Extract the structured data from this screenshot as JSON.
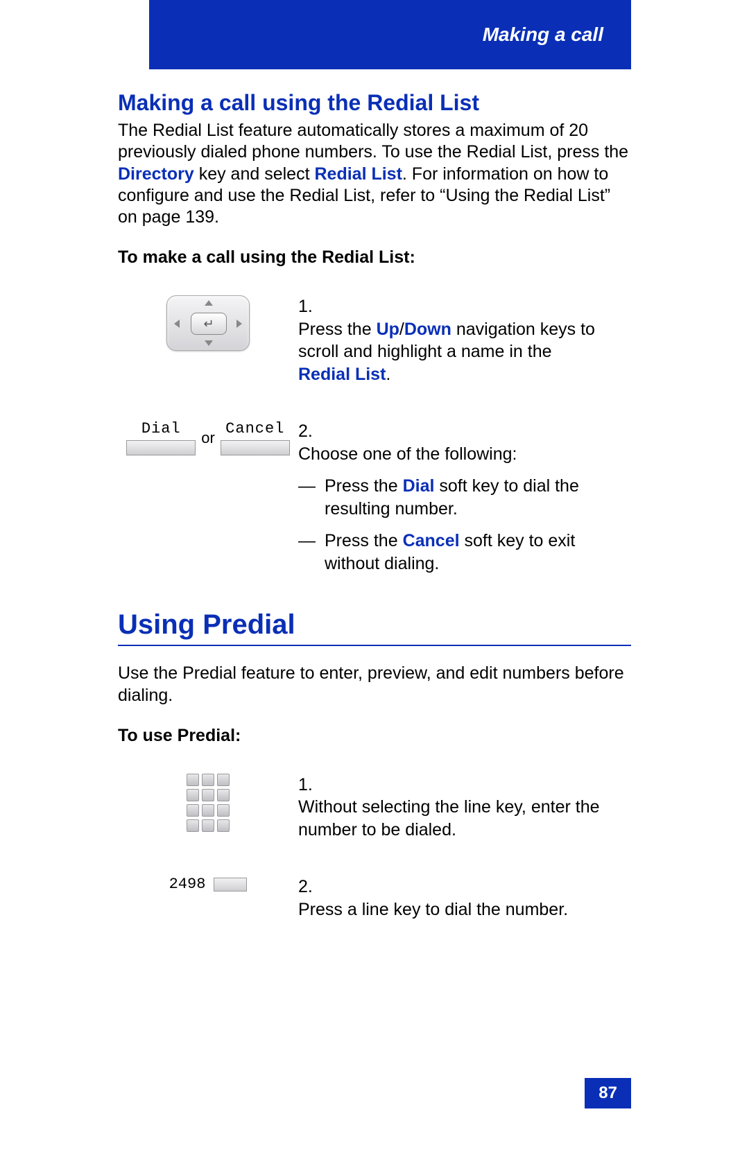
{
  "header": {
    "breadcrumb": "Making a call"
  },
  "section1": {
    "title": "Making a call using the Redial List",
    "intro_parts": [
      "The Redial List feature automatically stores a maximum of 20 previously dialed phone numbers. To use the Redial List, press the ",
      "Directory",
      " key and select ",
      "Redial List",
      ". For information on how to configure and use the Redial List, refer to “Using the Redial List” on page 139."
    ],
    "procedure_label": "To make a call using the Redial List:",
    "step1": {
      "num": "1.",
      "parts": [
        "Press the ",
        "Up",
        "/",
        "Down",
        " navigation keys to scroll and highlight a name in the ",
        "Redial List",
        "."
      ]
    },
    "step2": {
      "num": "2.",
      "lead": "Choose one of the following:",
      "optA": [
        "Press the ",
        "Dial",
        " soft key to dial the resulting number."
      ],
      "optB": [
        "Press the ",
        "Cancel",
        " soft key to exit without dialing."
      ]
    },
    "softkeys": {
      "dial": "Dial",
      "cancel": "Cancel",
      "or": "or"
    }
  },
  "section2": {
    "title": "Using Predial",
    "intro": "Use the Predial feature to enter, preview, and edit numbers before dialing.",
    "procedure_label": "To use Predial:",
    "step1": {
      "num": "1.",
      "text": "Without selecting the line key, enter the number to be dialed."
    },
    "step2": {
      "num": "2.",
      "text": "Press a line key to dial the number."
    },
    "linekey_number": "2498"
  },
  "footer": {
    "page": "87"
  }
}
